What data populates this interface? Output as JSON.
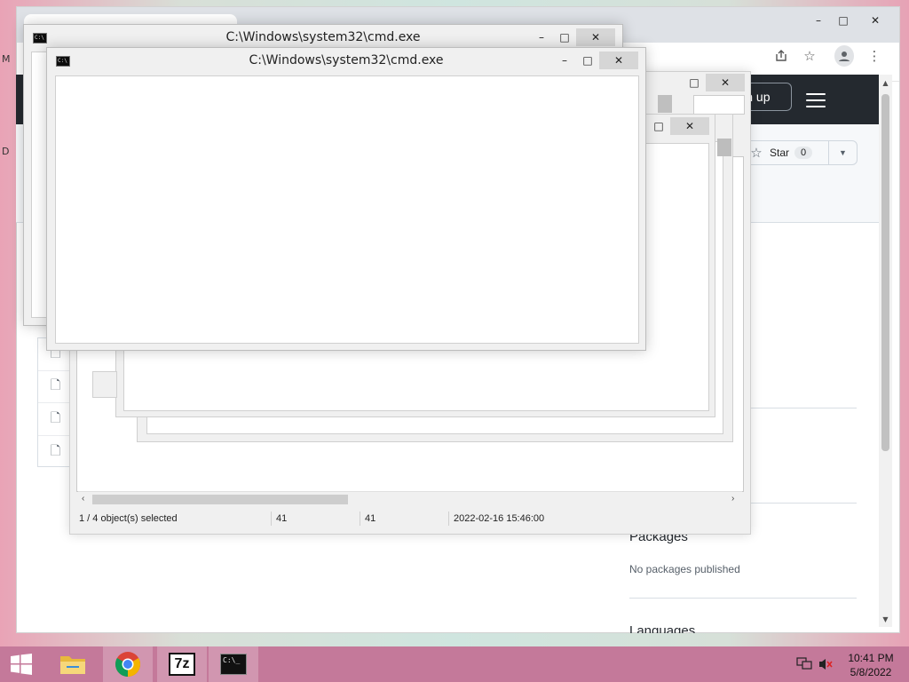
{
  "desktop": {
    "labels": [
      "M",
      "D"
    ]
  },
  "browser": {
    "window_controls": {
      "minimize": "–",
      "maximize": "□",
      "close": "✕"
    },
    "toolbar_icons": [
      "share-icon",
      "star-bookmark-icon",
      "profile-icon",
      "more-menu-icon"
    ],
    "header": {
      "signup_label": "Sign up",
      "signup_visible": "ign up"
    },
    "repo": {
      "star_label": "Star",
      "star_count": "0"
    },
    "sidebar": {
      "packages_title": "Packages",
      "packages_text": "No packages published",
      "languages_title": "Languages"
    },
    "file_icons": [
      "file-icon",
      "file-icon",
      "file-icon",
      "file-icon"
    ]
  },
  "explorer": {
    "status": {
      "selected": "1 / 4 object(s) selected",
      "size": "41",
      "packed": "41",
      "modified": "2022-02-16 15:46:00"
    }
  },
  "cmd_windows": [
    {
      "title": "C:\\Windows\\system32\\cmd.exe"
    },
    {
      "title": "C:\\Windows\\system32\\cmd.exe"
    }
  ],
  "taskbar": {
    "apps": [
      "start-button",
      "file-explorer",
      "chrome",
      "7-zip",
      "cmd"
    ],
    "seven_zip_label": "7z",
    "cmd_label": "C:\\_",
    "clock": {
      "time": "10:41 PM",
      "date": "5/8/2022"
    }
  }
}
